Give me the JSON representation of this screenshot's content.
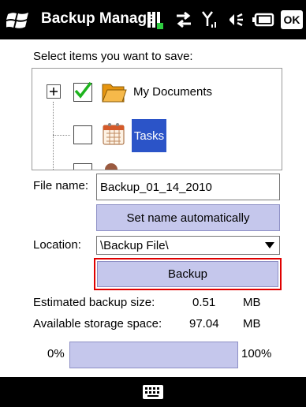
{
  "titlebar": {
    "title": "Backup Manage",
    "ok_label": "OK"
  },
  "tree": {
    "prompt": "Select items you want to save:",
    "items": [
      {
        "label": "My Documents",
        "checked": true,
        "expander": "+"
      },
      {
        "label": "Tasks",
        "checked": false,
        "selected": true
      },
      {
        "label": "",
        "checked": false
      }
    ]
  },
  "file_name": {
    "label": "File name:",
    "value": "Backup_01_14_2010"
  },
  "set_name_button": "Set name automatically",
  "location": {
    "label": "Location:",
    "value": "\\Backup File\\"
  },
  "backup_button": "Backup",
  "estimated_size": {
    "label": "Estimated backup size:",
    "value": "0.51",
    "unit": "MB"
  },
  "available_space": {
    "label": "Available storage space:",
    "value": "97.04",
    "unit": "MB"
  },
  "progress": {
    "min_label": "0%",
    "max_label": "100%",
    "fraction": 0
  },
  "colors": {
    "highlight": "#e00000",
    "button": "#c5c7ec",
    "selection": "#2b54c8"
  }
}
